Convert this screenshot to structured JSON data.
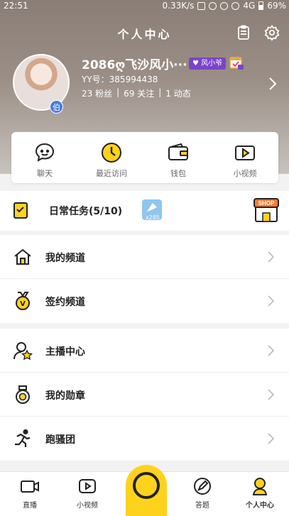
{
  "status_bar": {
    "time": "22:51",
    "speed": "0.33K/s",
    "network": "4G",
    "battery": "69%"
  },
  "header": {
    "title": "个人中心"
  },
  "profile": {
    "username": "2086ღ飞沙风小···",
    "level_badge": "风小爷",
    "yy_id": "YY号：385994438",
    "fans": "23 粉丝",
    "follows": "69 关注",
    "moments": "1 动态",
    "avatar_badge": "伯"
  },
  "quick_actions": [
    {
      "label": "聊天",
      "icon": "chat-icon"
    },
    {
      "label": "最近访问",
      "icon": "recent-visit-icon"
    },
    {
      "label": "钱包",
      "icon": "wallet-icon"
    },
    {
      "label": "小视频",
      "icon": "short-video-icon"
    }
  ],
  "task": {
    "label": "日常任务(5/10)",
    "reward_count": "x285"
  },
  "menu_group_1": [
    {
      "label": "我的频道",
      "icon": "home-icon"
    },
    {
      "label": "签约频道",
      "icon": "medal-v-icon"
    }
  ],
  "menu_group_2": [
    {
      "label": "主播中心",
      "icon": "anchor-star-icon"
    },
    {
      "label": "我的勋章",
      "icon": "badge-icon"
    },
    {
      "label": "跑骚团",
      "icon": "running-icon"
    }
  ],
  "bottom_nav": [
    {
      "label": "直播",
      "icon": "live-camera-icon"
    },
    {
      "label": "小视频",
      "icon": "video-play-icon"
    },
    {
      "label": "答题",
      "icon": "quiz-pen-icon"
    },
    {
      "label": "个人中心",
      "icon": "profile-icon"
    }
  ],
  "colors": {
    "accent": "#ffd21e",
    "level_badge": "#7b44c9",
    "badge_blue": "#4a79d8",
    "notification": "#ff5a3c"
  }
}
